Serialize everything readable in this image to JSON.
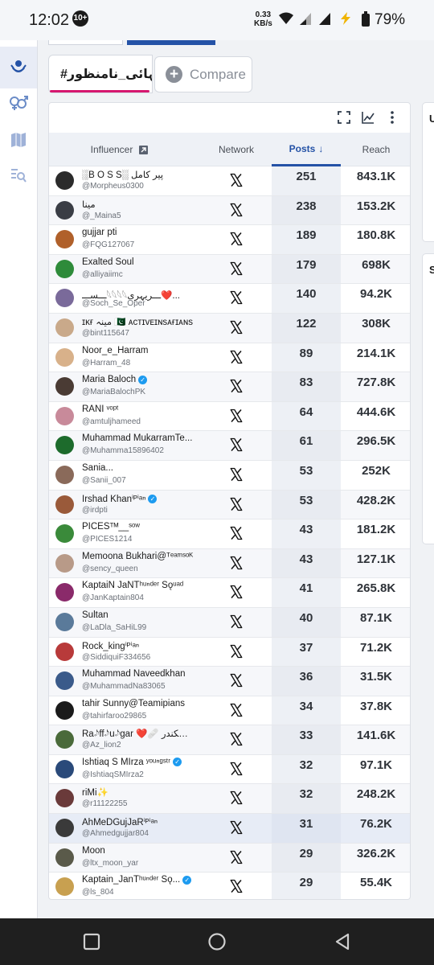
{
  "status_bar": {
    "time": "12:02",
    "badge": "10+",
    "speed_value": "0.33",
    "speed_unit": "KB/s",
    "battery": "79%"
  },
  "hashtag_tab": {
    "label": "#قیدتنہائی_نامنظور"
  },
  "compare_button": {
    "label": "Compare"
  },
  "right_cards": [
    {
      "label": "U"
    },
    {
      "label": "S"
    }
  ],
  "table": {
    "headers": {
      "influencer": "Influencer",
      "network": "Network",
      "posts": "Posts",
      "reach": "Reach"
    },
    "rows": [
      {
        "name": "░B O S S░ پیر کامل",
        "handle": "@Morpheus0300",
        "posts": "251",
        "reach": "843.1K",
        "avatar": "#2b2b2b",
        "verified": false
      },
      {
        "name": "مینا",
        "handle": "@_Maina5",
        "posts": "238",
        "reach": "153.2K",
        "avatar": "#3a3d45",
        "verified": false
      },
      {
        "name": "gujjar pti",
        "handle": "@FQG127067",
        "posts": "189",
        "reach": "180.8K",
        "avatar": "#b0602a",
        "verified": false
      },
      {
        "name": "Exalted Soul",
        "handle": "@alliyaiimc",
        "posts": "179",
        "reach": "698K",
        "avatar": "#2e8b3a",
        "verified": false
      },
      {
        "name": "ـــســـ𓆩𓆩𓆩𓆩ـــریہری❤️...",
        "handle": "@Soch_Se_Oper",
        "posts": "140",
        "reach": "94.2K",
        "avatar": "#7a6a9a",
        "verified": false
      },
      {
        "name": "ɪᴋғ مینہ 🇵🇰 ᴀᴄᴛɪᴠᴇɪɴsᴀғɪᴀɴs",
        "handle": "@bint115647",
        "posts": "122",
        "reach": "308K",
        "avatar": "#c9a98a",
        "verified": false
      },
      {
        "name": "Noor_e_Harram",
        "handle": "@Harram_48",
        "posts": "89",
        "reach": "214.1K",
        "avatar": "#d8b18a",
        "verified": false
      },
      {
        "name": "Maria Baloch",
        "handle": "@MariaBalochPK",
        "posts": "83",
        "reach": "727.8K",
        "avatar": "#4a3b34",
        "verified": true
      },
      {
        "name": "RANI ᵛᵒᵖᵗ",
        "handle": "@amtuljhameed",
        "posts": "64",
        "reach": "444.6K",
        "avatar": "#c88a9a",
        "verified": false
      },
      {
        "name": "Muhammad MukarramTe...",
        "handle": "@Muhamma15896402",
        "posts": "61",
        "reach": "296.5K",
        "avatar": "#1d6b2c",
        "verified": false
      },
      {
        "name": "Sania...",
        "handle": "@Sanii_007",
        "posts": "53",
        "reach": "252K",
        "avatar": "#8a6a5a",
        "verified": false
      },
      {
        "name": "Irshad Khanⁱᴾⁱᵃⁿ",
        "handle": "@irdpti",
        "posts": "53",
        "reach": "428.2K",
        "avatar": "#9a5a3a",
        "verified": true
      },
      {
        "name": "PICESᵀᴹ__ˢᵒʷ",
        "handle": "@PICES1214",
        "posts": "43",
        "reach": "181.2K",
        "avatar": "#3a8a3a",
        "verified": false
      },
      {
        "name": "Memoona Bukhari@ᵀᵉᵃᵐˢᵒᴷ",
        "handle": "@sency_queen",
        "posts": "43",
        "reach": "127.1K",
        "avatar": "#b89a88",
        "verified": false
      },
      {
        "name": "KaptaiN JaNTʰᵘⁿᵈᵉʳ Sǫᵘᵃᵈ",
        "handle": "@JanKaptain804",
        "posts": "41",
        "reach": "265.8K",
        "avatar": "#8a2a6a",
        "verified": false
      },
      {
        "name": "Sultan",
        "handle": "@LaDla_SaHiL99",
        "posts": "40",
        "reach": "87.1K",
        "avatar": "#5a7a9a",
        "verified": false
      },
      {
        "name": "Rock_kingⁱᴾⁱᵃⁿ",
        "handle": "@SiddiquiF334656",
        "posts": "37",
        "reach": "71.2K",
        "avatar": "#b83a3a",
        "verified": false
      },
      {
        "name": "Muhammad Naveedkhan",
        "handle": "@MuhammadNa83065",
        "posts": "36",
        "reach": "31.5K",
        "avatar": "#3a5a8a",
        "verified": false
      },
      {
        "name": "tahir Sunny@Teamipians",
        "handle": "@tahirfaroo29865",
        "posts": "34",
        "reach": "37.8K",
        "avatar": "#1b1b1b",
        "verified": false
      },
      {
        "name": "Ra𝆹𝅥𝅮ff𝆹𝅥𝅮u𝆹𝅥𝅮gar ❤️🩹 سالار سکندر",
        "handle": "@Az_lion2",
        "posts": "33",
        "reach": "141.6K",
        "avatar": "#4a6a3a",
        "verified": false
      },
      {
        "name": "Ishtiaq S MIrza ʸᵒᵘⁿᵍˢᵗʳ",
        "handle": "@IshtiaqSMIrza2",
        "posts": "32",
        "reach": "97.1K",
        "avatar": "#2a4a7a",
        "verified": true
      },
      {
        "name": "riMi✨",
        "handle": "@r11122255",
        "posts": "32",
        "reach": "248.2K",
        "avatar": "#6a3a3a",
        "verified": false
      },
      {
        "name": "AhMeDGujJaRⁱᴾⁱᵃⁿ",
        "handle": "@Ahmedgujjar804",
        "posts": "31",
        "reach": "76.2K",
        "avatar": "#3a3a3a",
        "verified": false
      },
      {
        "name": "Moon",
        "handle": "@ltx_moon_yar",
        "posts": "29",
        "reach": "326.2K",
        "avatar": "#5a5a4a",
        "verified": false
      },
      {
        "name": "Kaptain_JanTʰᵘⁿᵈᵉʳ Sǫ...",
        "handle": "@ls_804",
        "posts": "29",
        "reach": "55.4K",
        "avatar": "#c8a050",
        "verified": true
      }
    ]
  }
}
